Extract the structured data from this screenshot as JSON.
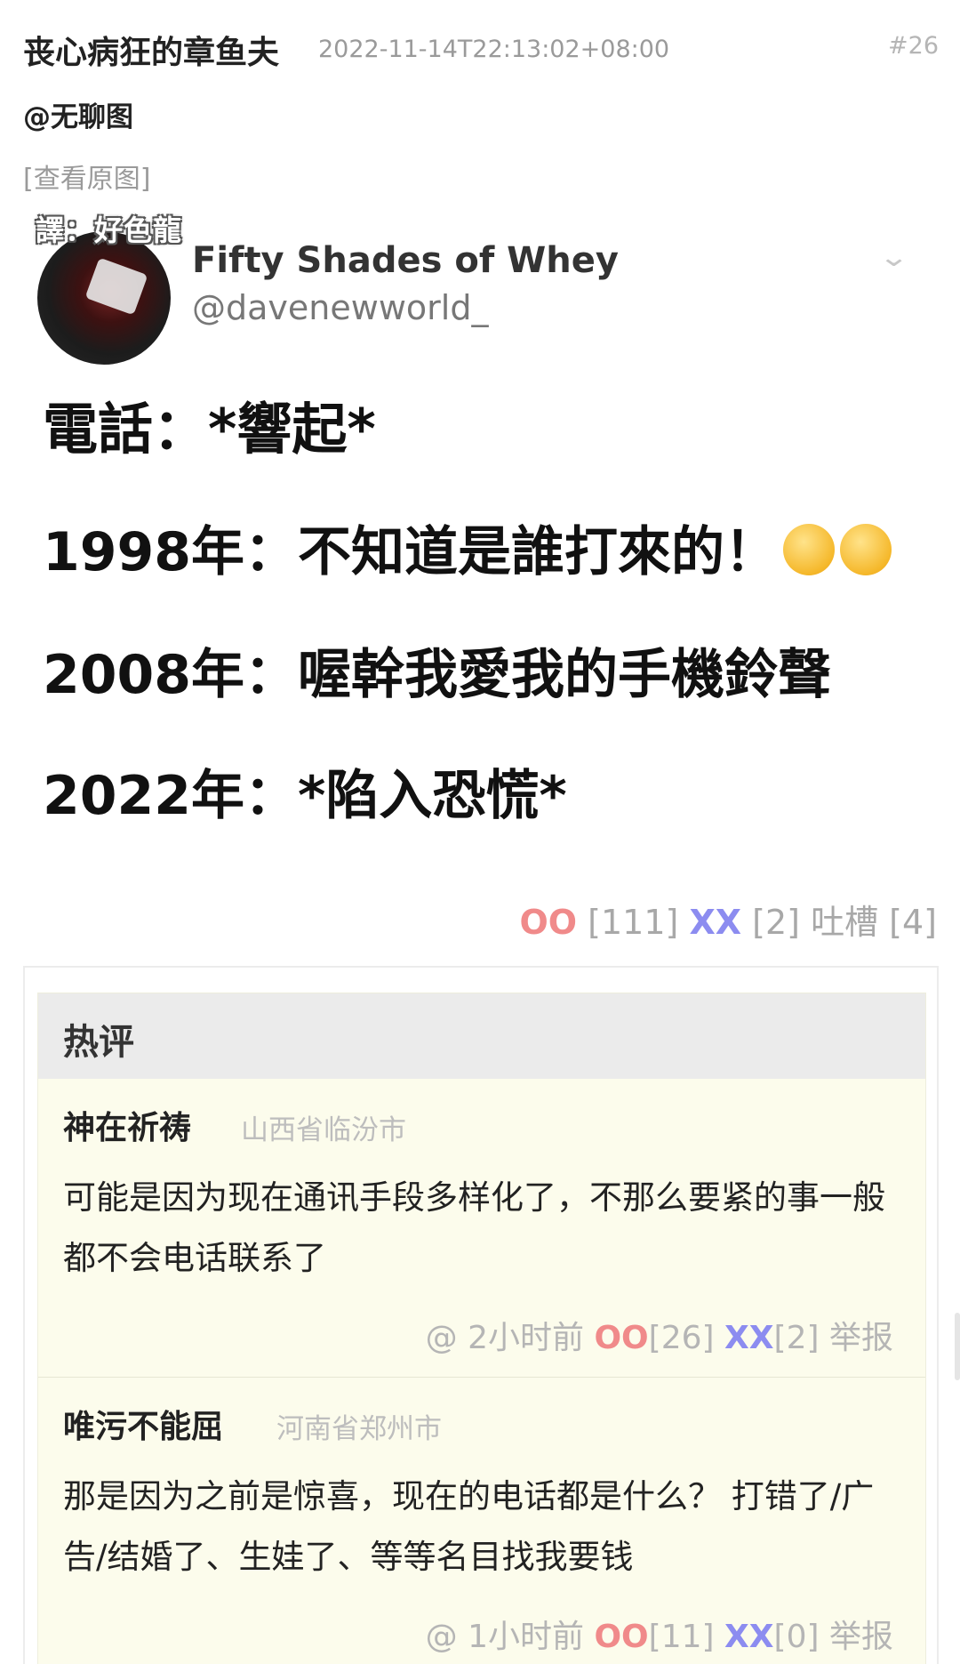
{
  "post": {
    "author": "丧心病狂的章鱼夫",
    "timestamp": "2022-11-14T22:13:02+08:00",
    "number": "#26",
    "mention": "@无聊图",
    "view_original": "[查看原图]"
  },
  "image": {
    "translator": "譯：好色龍",
    "tweet_name": "Fifty Shades of Whey",
    "tweet_handle": "@davenewworld_",
    "lines": [
      "電話：*響起*",
      "1998年：不知道是誰打來的！",
      "2008年：喔幹我愛我的手機鈴聲",
      "2022年：*陷入恐慌*"
    ]
  },
  "votes": {
    "oo_label": "OO",
    "oo_count": "[111]",
    "xx_label": "XX",
    "xx_count": "[2]",
    "tucao_label": "吐槽",
    "tucao_count": "[4]"
  },
  "hot_comments": {
    "title": "热评",
    "items": [
      {
        "author": "神在祈祷",
        "location": "山西省临汾市",
        "text": "可能是因为现在通讯手段多样化了，不那么要紧的事一般都不会电话联系了",
        "reply": "@",
        "time": "2小时前",
        "oo_label": "OO",
        "oo_count": "[26]",
        "xx_label": "XX",
        "xx_count": "[2]",
        "report": "举报"
      },
      {
        "author": "唯污不能屈",
        "location": "河南省郑州市",
        "text": "那是因为之前是惊喜，现在的电话都是什么？ 打错了/广告/结婚了、生娃了、等等名目找我要钱",
        "reply": "@",
        "time": "1小时前",
        "oo_label": "OO",
        "oo_count": "[11]",
        "xx_label": "XX",
        "xx_count": "[0]",
        "report": "举报"
      }
    ]
  },
  "colors": {
    "oo": "#f08a8a",
    "xx": "#8c8cf0",
    "muted": "#a8a8a8",
    "comment_bg": "#fcfcec"
  },
  "icons": [
    "chevron-down-icon",
    "smiley-emoji-icon",
    "avatar-image"
  ]
}
